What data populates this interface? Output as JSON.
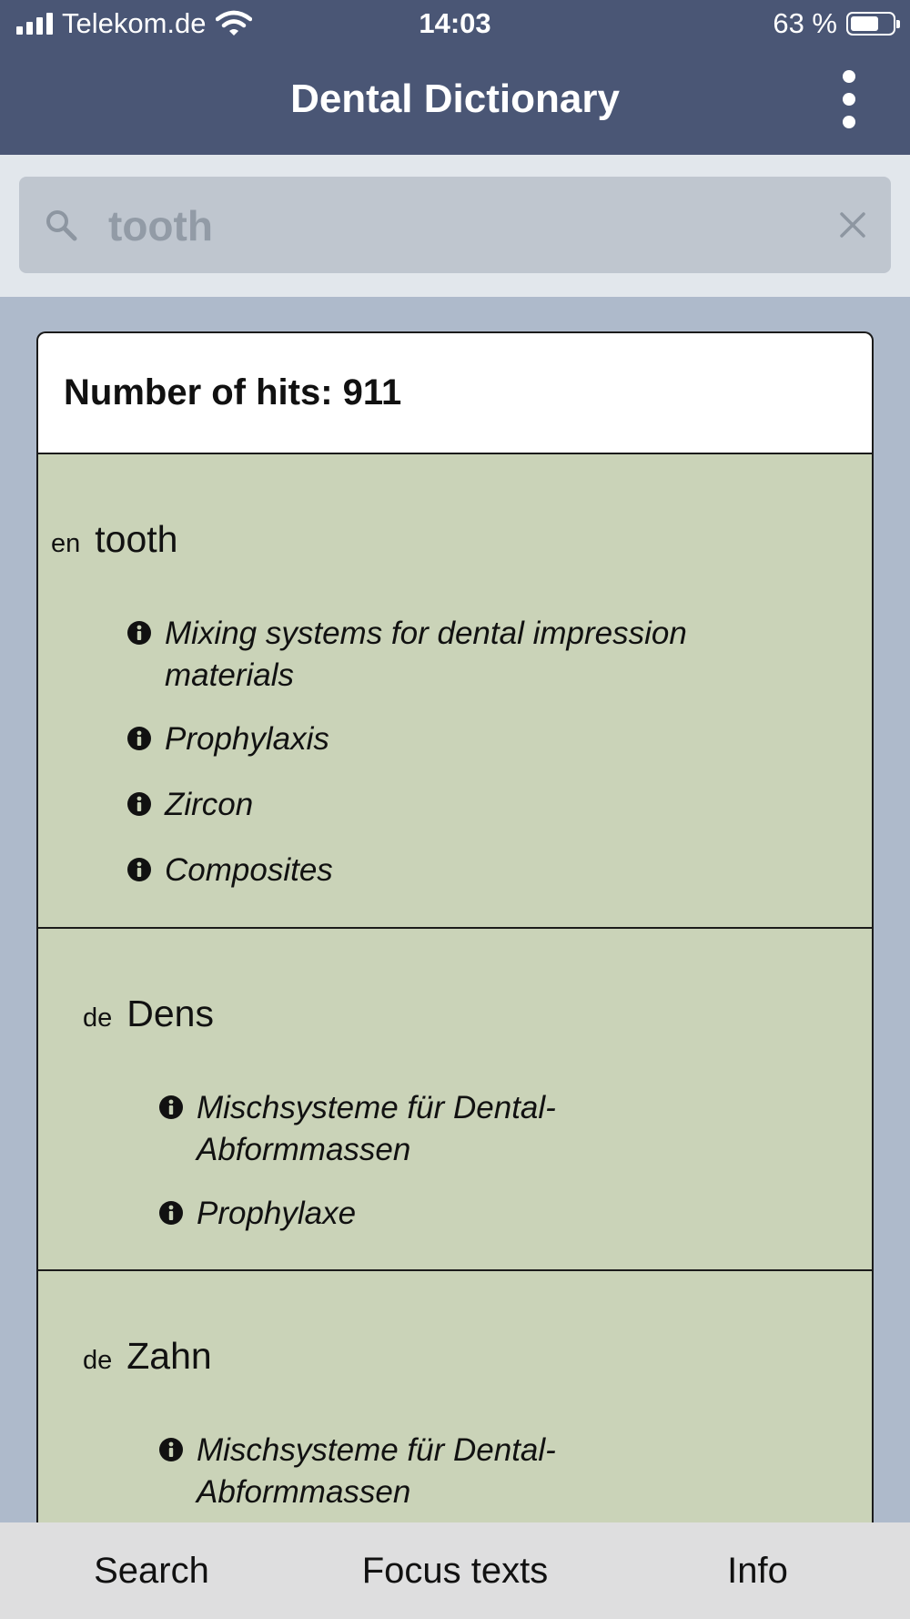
{
  "status_bar": {
    "carrier": "Telekom.de",
    "time": "14:03",
    "battery": "63 %"
  },
  "app_bar": {
    "title": "Dental Dictionary",
    "menu_icon": "more-vertical-icon"
  },
  "search": {
    "value": "tooth",
    "icon": "search-icon",
    "clear_icon": "close-icon"
  },
  "results": {
    "hits_label": "Number of hits:",
    "hits_count": "911",
    "entries": [
      {
        "lang": "en",
        "term": "tooth",
        "refs": [
          "Mixing systems for dental impression materials",
          "Prophylaxis",
          "Zircon",
          "Composites"
        ]
      },
      {
        "lang": "de",
        "term": "Dens",
        "refs": [
          "Mischsysteme für Dental-Abformmassen",
          "Prophylaxe"
        ]
      },
      {
        "lang": "de",
        "term": "Zahn",
        "refs": [
          "Mischsysteme für Dental-Abformmassen"
        ]
      }
    ]
  },
  "tab_bar": {
    "tabs": [
      "Search",
      "Focus texts",
      "Info"
    ]
  },
  "colors": {
    "header": "#4a5675",
    "entry_bg": "#cad3b8",
    "page_bg": "#aebacb"
  }
}
